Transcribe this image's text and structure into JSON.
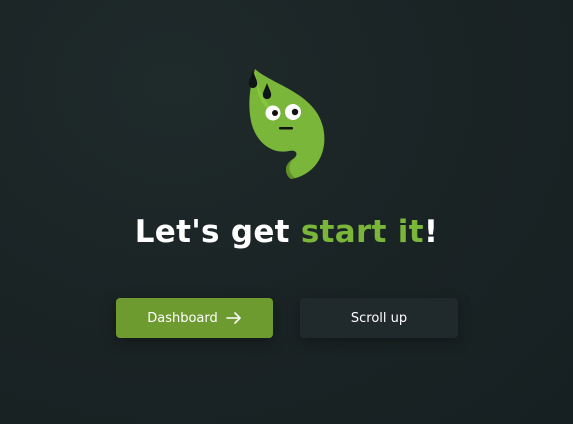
{
  "hero": {
    "headline_prefix": "Let's get ",
    "headline_accent": "start it",
    "headline_suffix": "!",
    "mascot_icon": "sweating-leaf-mascot-icon"
  },
  "actions": {
    "dashboard_label": "Dashboard",
    "dashboard_icon": "arrow-right-icon",
    "scroll_up_label": "Scroll up"
  },
  "colors": {
    "accent": "#7ab63a",
    "primary_button": "#6e9b30",
    "secondary_button": "#202a2c",
    "background": "#1a2324"
  }
}
